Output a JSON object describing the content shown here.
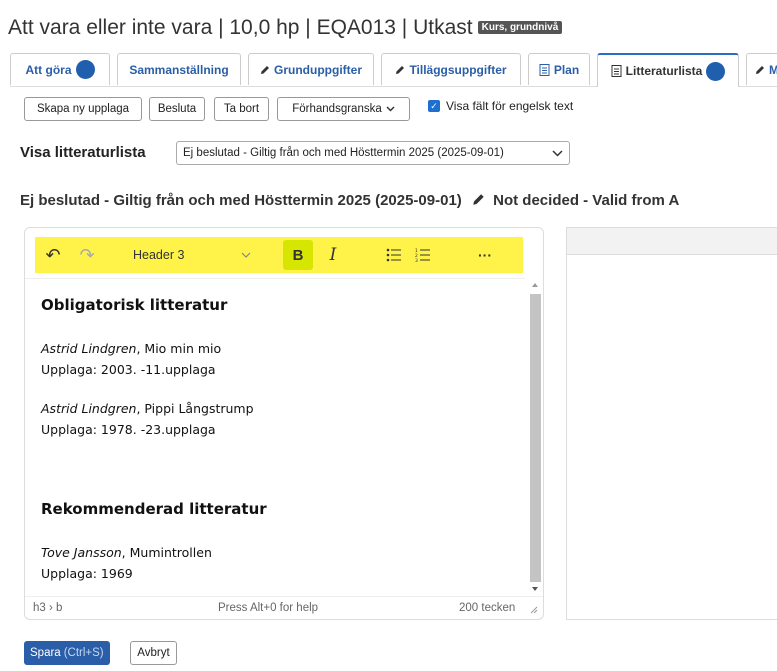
{
  "header": {
    "title": "Att vara eller inte vara | 10,0 hp | EQA013 | Utkast",
    "badge": "Kurs, grundnivå"
  },
  "tabs": [
    {
      "label": "Att göra",
      "has_dot": true
    },
    {
      "label": "Sammanställning"
    },
    {
      "label": "Grunduppgifter",
      "icon": "pencil-icon"
    },
    {
      "label": "Tilläggsuppgifter",
      "icon": "pencil-icon"
    },
    {
      "label": "Plan",
      "icon": "document-icon"
    },
    {
      "label": "Litteraturlista",
      "icon": "document-icon",
      "active": true,
      "has_dot": true
    },
    {
      "label": "M",
      "icon": "pencil-icon"
    }
  ],
  "toolbar": {
    "create_edition": "Skapa ny upplaga",
    "decide": "Besluta",
    "delete": "Ta bort",
    "preview": "Förhandsgranska",
    "show_english": "Visa fält för engelsk text",
    "show_english_checked": true
  },
  "version_select": {
    "label": "Visa litteraturlista",
    "value": "Ej beslutad - Giltig från och med Hösttermin 2025 (2025-09-01)"
  },
  "section": {
    "sv_heading": "Ej beslutad - Giltig från och med Hösttermin 2025 (2025-09-01)",
    "en_heading": "Not decided - Valid from A"
  },
  "editor": {
    "block_format": "Header 3",
    "content": {
      "h1": "Obligatorisk litteratur",
      "items": [
        {
          "author": "Astrid Lindgren",
          "title": ", Mio min mio",
          "edition": "Upplaga: 2003. -11.upplaga"
        },
        {
          "author": "Astrid Lindgren",
          "title": ", Pippi Långstrump",
          "edition": "Upplaga: 1978. -23.upplaga"
        }
      ],
      "h2": "Rekommenderad litteratur",
      "items2": [
        {
          "author": "Tove Jansson",
          "title": ", Mumintrollen",
          "edition": "Upplaga: 1969"
        }
      ]
    },
    "status": {
      "path": "h3 › b",
      "help": "Press Alt+0 for help",
      "count": "200 tecken"
    }
  },
  "footer": {
    "save": "Spara",
    "save_shortcut": "(Ctrl+S)",
    "cancel": "Avbryt"
  }
}
